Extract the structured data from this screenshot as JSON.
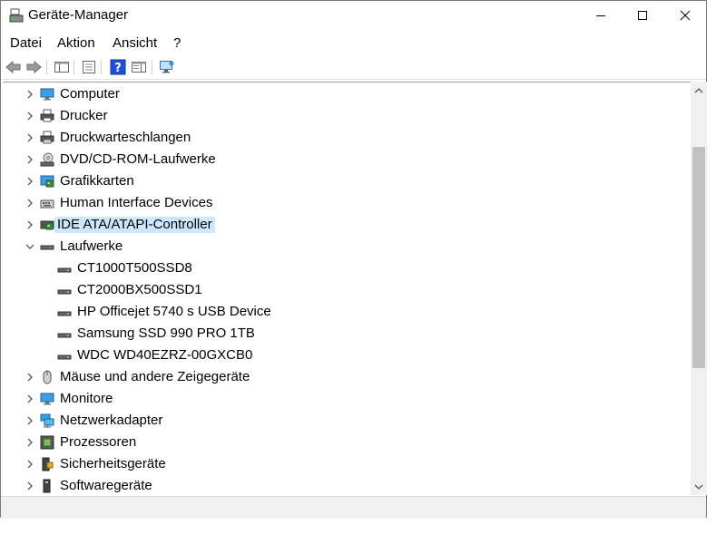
{
  "window": {
    "title": "Geräte-Manager"
  },
  "menu": [
    {
      "label": "Datei"
    },
    {
      "label": "Aktion"
    },
    {
      "label": "Ansicht"
    },
    {
      "label": "?"
    }
  ],
  "toolbar": {
    "icons": [
      "back-arrow-icon",
      "forward-arrow-icon",
      "properties-list-icon",
      "details-view-icon",
      "help-icon",
      "panel-view-icon",
      "monitor-scan-icon"
    ]
  },
  "tree": {
    "categories": [
      {
        "label": "Computer",
        "icon": "computer-icon",
        "expanded": false
      },
      {
        "label": "Drucker",
        "icon": "printer-icon",
        "expanded": false
      },
      {
        "label": "Druckwarteschlangen",
        "icon": "print-queue-icon",
        "expanded": false
      },
      {
        "label": "DVD/CD-ROM-Laufwerke",
        "icon": "optical-drive-icon",
        "expanded": false
      },
      {
        "label": "Grafikkarten",
        "icon": "display-adapter-icon",
        "expanded": false
      },
      {
        "label": "Human Interface Devices",
        "icon": "hid-icon",
        "expanded": false
      },
      {
        "label": "IDE ATA/ATAPI-Controller",
        "icon": "ide-controller-icon",
        "expanded": false,
        "selected": true
      },
      {
        "label": "Laufwerke",
        "icon": "drive-icon",
        "expanded": true,
        "children": [
          {
            "label": "CT1000T500SSD8"
          },
          {
            "label": "CT2000BX500SSD1"
          },
          {
            "label": "HP Officejet 5740 s USB Device"
          },
          {
            "label": "Samsung SSD 990 PRO 1TB"
          },
          {
            "label": "WDC WD40EZRZ-00GXCB0"
          }
        ]
      },
      {
        "label": "Mäuse und andere Zeigegeräte",
        "icon": "mouse-icon",
        "expanded": false
      },
      {
        "label": "Monitore",
        "icon": "monitor-icon",
        "expanded": false
      },
      {
        "label": "Netzwerkadapter",
        "icon": "network-adapter-icon",
        "expanded": false
      },
      {
        "label": "Prozessoren",
        "icon": "processor-icon",
        "expanded": false
      },
      {
        "label": "Sicherheitsgeräte",
        "icon": "security-device-icon",
        "expanded": false
      },
      {
        "label": "Softwaregeräte",
        "icon": "software-device-icon",
        "expanded": false
      }
    ]
  },
  "colors": {
    "selection": "#cce8ff",
    "accent": "#1f7fd6"
  }
}
